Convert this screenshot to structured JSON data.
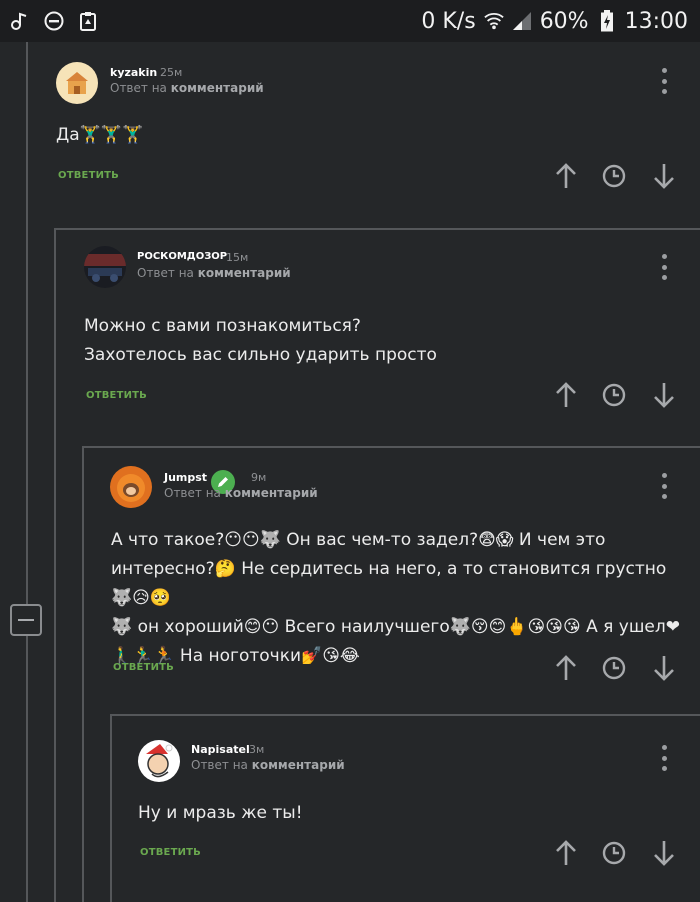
{
  "status_bar": {
    "network_speed": "0 K/s",
    "battery_percent": "60%",
    "time": "13:00"
  },
  "comments": [
    {
      "author": "kyzakin",
      "time": "25м",
      "reply_prefix": "Ответ на",
      "reply_target": "комментарий",
      "text_lines": [
        "Да🏋‍♂🏋‍♂🏋‍♂"
      ],
      "reply_label": "ОТВЕТИТЬ"
    },
    {
      "author": "РОСКОМДОЗОР",
      "time": "15м",
      "reply_prefix": "Ответ на",
      "reply_target": "комментарий",
      "text_lines": [
        "Можно с вами познакомиться?",
        "Захотелось вас сильно ударить просто"
      ],
      "reply_label": "ОТВЕТИТЬ"
    },
    {
      "author": "Jumpst",
      "time": "9м",
      "reply_prefix": "Ответ на",
      "reply_target": "комментарий",
      "text_lines": [
        "А что такое?😶😶🐺 Он вас чем-то задел?😨😱 И чем это",
        "интересно?🤔 Не сердитесь на него, а то становится грустно🐺😥🥺",
        "🐺 он хороший😊😶 Всего наилучшего🐺😚😊🖕😘😘😘 А я ушел❤",
        "🚶‍♂🏃‍♂🏃 На ноготочки💅😘😂"
      ],
      "reply_label": "ОТВЕТИТЬ"
    },
    {
      "author": "Napisatel",
      "time": "3м",
      "reply_prefix": "Ответ на",
      "reply_target": "комментарий",
      "text_lines": [
        "Ну и мразь же ты!"
      ],
      "reply_label": "ОТВЕТИТЬ"
    }
  ],
  "colors": {
    "background": "#252729",
    "reply_green": "#6aa84f",
    "thread_line": "#55575a",
    "edit_badge": "#4caf50"
  },
  "icons": [
    "music-note-icon",
    "do-not-disturb-icon",
    "clipboard-icon",
    "wifi-icon",
    "signal-icon",
    "battery-charging-icon",
    "kebab-menu-icon",
    "upvote-arrow-icon",
    "clock-icon",
    "downvote-arrow-icon",
    "pencil-icon",
    "collapse-minus-icon"
  ]
}
